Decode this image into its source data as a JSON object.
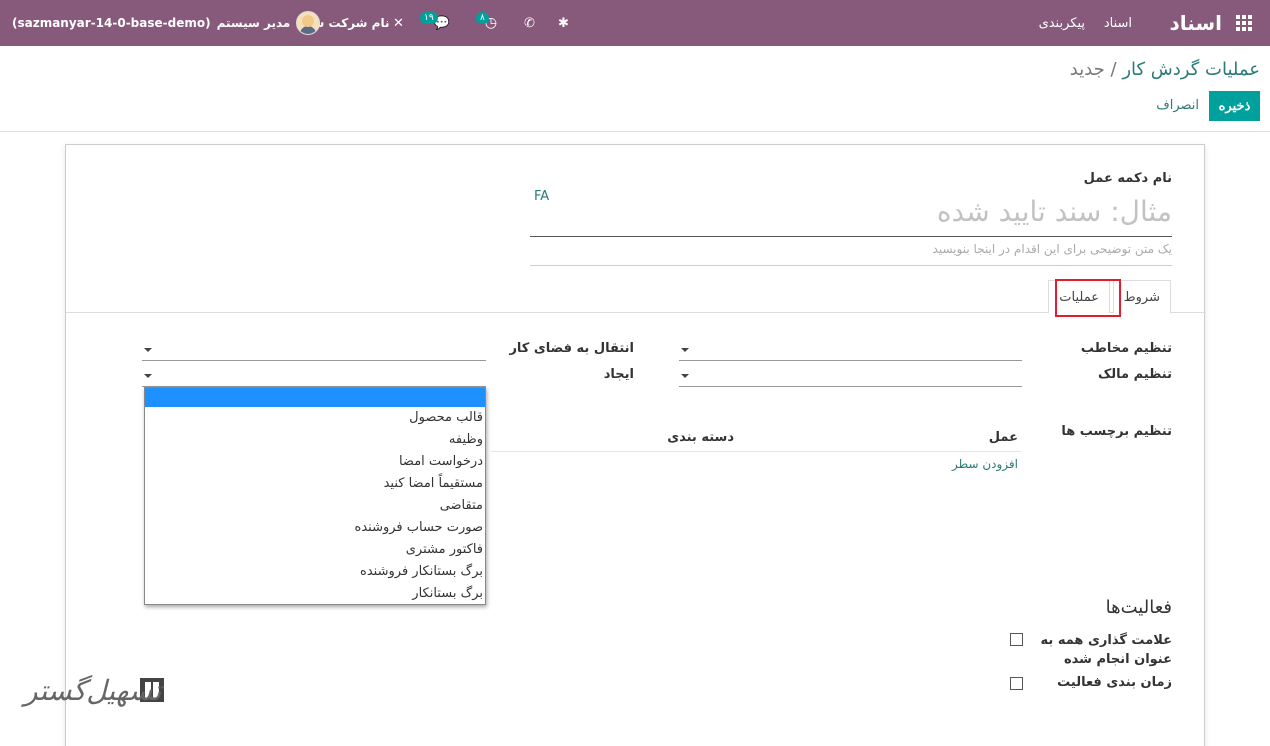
{
  "navbar": {
    "brand": "اسناد",
    "menu": [
      "اسناد",
      "پیکربندی"
    ],
    "company": "نام شرکت شما",
    "user": "مدیر سیستم",
    "database": "(sazmanyar-14-0-base-demo)",
    "activity_badge": "۸",
    "messages_badge": "۱۹"
  },
  "breadcrumb": {
    "parent": "عملیات گردش کار",
    "separator": "/",
    "current": "جدید"
  },
  "buttons": {
    "save": "ذخیره",
    "discard": "انصراف"
  },
  "form": {
    "name_label": "نام دکمه عمل",
    "name_placeholder": "مثال: سند تایید شده",
    "lang": "FA",
    "description_placeholder": "یک متن توضیحی برای این اقدام در اینجا بنویسید",
    "tabs": [
      "شروط",
      "عملیات"
    ],
    "fields": {
      "set_partner": "تنظیم مخاطب",
      "set_owner": "تنظیم مالک",
      "move_to_workspace": "انتقال به فضای کار",
      "create": "ایجاد",
      "set_tags": "تنظیم برچسب ها"
    },
    "tags_table": {
      "col_action": "عمل",
      "col_category": "دسته بندی",
      "add_line": "افزودن سطر"
    },
    "create_dropdown": {
      "options": [
        "",
        "قالب محصول",
        "وظیفه",
        "درخواست امضا",
        "مستقیماً امضا کنید",
        "متقاضی",
        "صورت حساب فروشنده",
        "فاکتور مشتری",
        "برگ بستانکار فروشنده",
        "برگ بستانکار"
      ]
    },
    "activities": {
      "title": "فعالیت‌ها",
      "mark_all_done_line1": "علامت گذاری همه به",
      "mark_all_done_line2": "عنوان انجام شده",
      "schedule": "زمان بندی فعالیت"
    }
  },
  "watermark": "تسهیل‌گستر"
}
